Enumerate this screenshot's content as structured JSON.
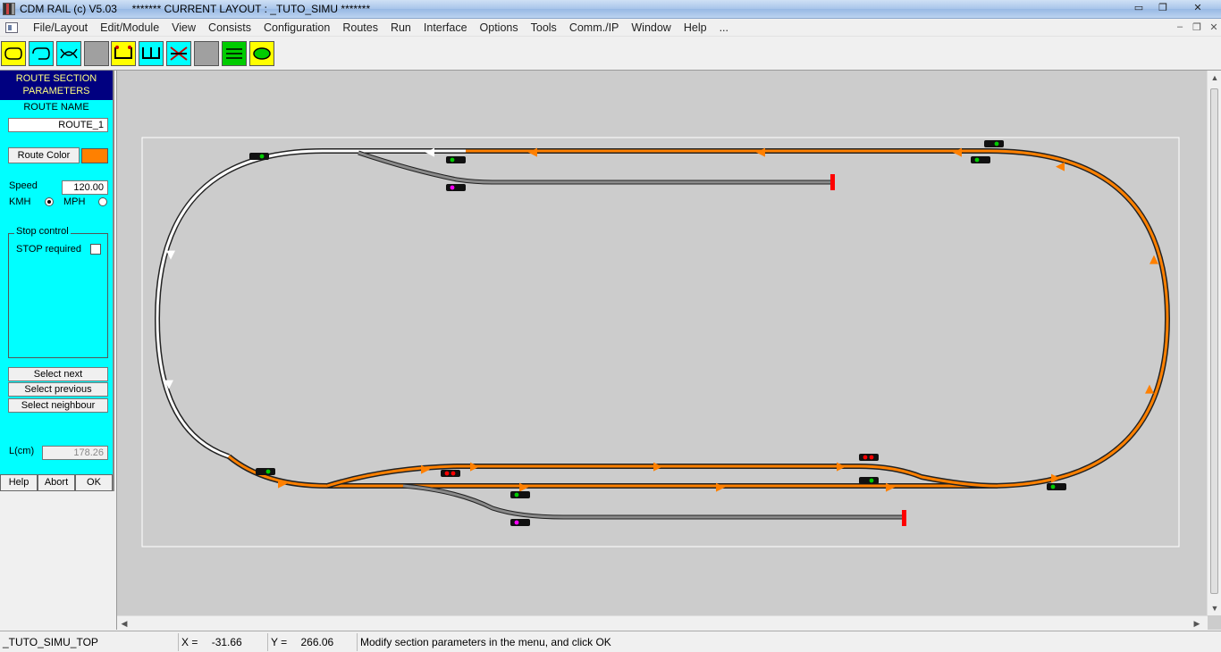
{
  "window": {
    "title": "CDM RAIL (c) V5.03     ******* CURRENT LAYOUT : _TUTO_SIMU *******",
    "minimize_label": "▭",
    "maximize_label": "❐",
    "close_label": "✕"
  },
  "menu": {
    "items": [
      "File/Layout",
      "Edit/Module",
      "View",
      "Consists",
      "Configuration",
      "Routes",
      "Run",
      "Interface",
      "Options",
      "Tools",
      "Comm./IP",
      "Window",
      "Help",
      "..."
    ],
    "mdi_min": "–",
    "mdi_restore": "❐",
    "mdi_close": "✕"
  },
  "toolbar": {
    "buttons": [
      {
        "icon": "loop-left-icon",
        "bg": "#ffff00"
      },
      {
        "icon": "loop-right-icon",
        "bg": "#00ffff"
      },
      {
        "icon": "cross-loop-icon",
        "bg": "#00ffff"
      },
      {
        "icon": "blank-icon",
        "bg": "#a0a0a0"
      },
      {
        "icon": "track-yellow-icon",
        "bg": "#ffff00"
      },
      {
        "icon": "track-cyan-icon",
        "bg": "#00ffff"
      },
      {
        "icon": "track-crossed-icon",
        "bg": "#00ffff"
      },
      {
        "icon": "blank-icon",
        "bg": "#a0a0a0"
      },
      {
        "icon": "lines-icon",
        "bg": "#00cc00"
      },
      {
        "icon": "oval-icon",
        "bg": "#ffff00"
      }
    ]
  },
  "panel": {
    "header_line1": "ROUTE SECTION",
    "header_line2": "PARAMETERS",
    "route_name_label": "ROUTE NAME",
    "route_name_value": "ROUTE_1",
    "route_color_label": "Route Color",
    "route_color": "#ff8000",
    "speed_label": "Speed",
    "speed_value": "120.00",
    "kmh_label": "KMH",
    "mph_label": "MPH",
    "unit_selected": "KMH",
    "stop_control_label": "Stop control",
    "stop_required_label": "STOP required",
    "stop_required": false,
    "select_next_label": "Select next",
    "select_previous_label": "Select previous",
    "select_neighbour_label": "Select neighbour",
    "length_label": "L(cm)",
    "length_value": "178.26",
    "help_label": "Help",
    "abort_label": "Abort",
    "ok_label": "OK"
  },
  "layout": {
    "background": "#cccccc",
    "route_color": "#ff8000",
    "selected_color": "#ffffff",
    "track_color": "#222222",
    "buffer_color": "#ff0000"
  },
  "status": {
    "module": "_TUTO_SIMU_TOP",
    "x_label": "X =",
    "x_value": "-31.66",
    "y_label": "Y =",
    "y_value": "266.06",
    "message": "Modify section parameters in the menu, and click OK"
  }
}
